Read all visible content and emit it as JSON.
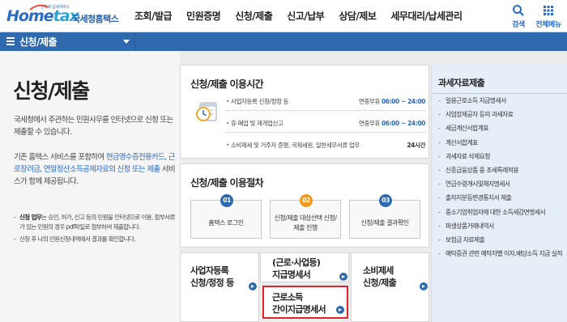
{
  "header": {
    "logo_tagline": "전자로 납세서비스",
    "logo_mark_a": "Home",
    "logo_mark_b": "tax",
    "logo_name": "국세청홈택스",
    "menu": [
      "조회/발급",
      "민원증명",
      "신청/제출",
      "신고/납부",
      "상담/제보",
      "세무대리/납세관리"
    ],
    "search_label": "검색",
    "allmenu_label": "전체메뉴",
    "accent": "#2f6aae"
  },
  "subbar": {
    "current": "신청/제출"
  },
  "intro": {
    "title": "신청/제출",
    "desc": "국세청에서 주관하는 민원사무를 인터넷으로 신청 또는 제출할 수 있습니다.",
    "desc2_a": "기존 홈택스 서비스를 포함하여 ",
    "desc2_hl": "현금영수증전용카드, 근로장려금, 연말정산소득공제자료의 신청 또는 제출",
    "desc2_b": " 서비스가 함께 제공됩니다.",
    "note1_bold": "신청 업무",
    "note1_rest": "는 승인, 허가, 신고 등의 민원을 인터넷으로 이용, 첨부서류가 있는 민원의 경우 pdf파일로 첨부하여 제출합니다.",
    "note2": "신청 후 나의 민원신청내역에서 결과를 확인합니다."
  },
  "time_card": {
    "title": "신청/제출 이용시간",
    "rows": [
      {
        "label": "사업자등록 신청/정정 등",
        "prefix": "연중무휴 ",
        "time": "06:00 ~ 24:00"
      },
      {
        "label": "휴·폐업 및 재개업신고",
        "prefix": "연중무휴 ",
        "time": "06:00 ~ 24:00"
      },
      {
        "label": "소비제세 및 거주자 증명, 국제세원, 일반세무서류 업무",
        "prefix": "",
        "time": "24시간"
      }
    ]
  },
  "proc_card": {
    "title": "신청/제출 이용절차",
    "steps": [
      {
        "num": "01",
        "text": "홈택스 로그인"
      },
      {
        "num": "02",
        "text": "신청/제출 대상선택 신청/제출 진행"
      },
      {
        "num": "03",
        "text": "신청/제출 결과확인"
      }
    ]
  },
  "quick": {
    "biz_line1": "사업자등록",
    "biz_line2": "신청/정정 등",
    "wage_line1": "(근로·사업등)",
    "wage_line2": "지급명세서",
    "simple_line1": "근로소득",
    "simple_line2": "간이지급명세서",
    "cons_line1": "소비제세",
    "cons_line2": "신청/제출",
    "highlight_color": "#e0242b"
  },
  "right_panel": {
    "title": "과세자료제출",
    "items": [
      "일용근로소득 지급명세서",
      "사업장제공자 등의 과세자료",
      "세금계산서합계표",
      "계산서합계표",
      "과세자료 삭제요청",
      "신종금융상품 중 조세특례적용",
      "연금수령개시및해지명세서",
      "출자지분등변경통지서 제출",
      "중소기업취업자에 대한 소득세감면명세서",
      "파생상품거래내역서",
      "보험금 자료제출",
      "예탁증권 관련 예탁자별 이자.배당소득 지급 실적"
    ]
  }
}
